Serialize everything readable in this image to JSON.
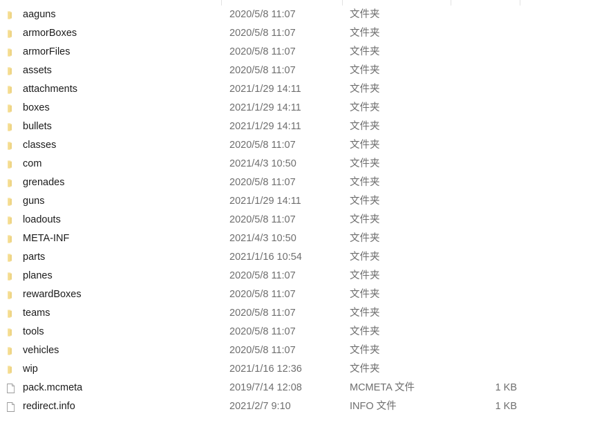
{
  "window": {
    "view": "details-list",
    "colors": {
      "folder_icon": "#f5dc8f",
      "folder_icon_dark": "#e7c765",
      "file_icon_fill": "#ffffff",
      "file_icon_border": "#9a9a9a",
      "name_text": "#1b1b1b",
      "meta_text": "#6e6e6e",
      "column_tick": "#e2e2e2",
      "background": "#ffffff"
    }
  },
  "columns": {
    "dividers_x": [
      320,
      495,
      652,
      752
    ],
    "keys": [
      "name",
      "date",
      "type",
      "size"
    ]
  },
  "items": [
    {
      "name": "aaguns",
      "date": "2020/5/8 11:07",
      "type": "文件夹",
      "size": "",
      "icon": "folder-icon"
    },
    {
      "name": "armorBoxes",
      "date": "2020/5/8 11:07",
      "type": "文件夹",
      "size": "",
      "icon": "folder-icon"
    },
    {
      "name": "armorFiles",
      "date": "2020/5/8 11:07",
      "type": "文件夹",
      "size": "",
      "icon": "folder-icon"
    },
    {
      "name": "assets",
      "date": "2020/5/8 11:07",
      "type": "文件夹",
      "size": "",
      "icon": "folder-icon"
    },
    {
      "name": "attachments",
      "date": "2021/1/29 14:11",
      "type": "文件夹",
      "size": "",
      "icon": "folder-icon"
    },
    {
      "name": "boxes",
      "date": "2021/1/29 14:11",
      "type": "文件夹",
      "size": "",
      "icon": "folder-icon"
    },
    {
      "name": "bullets",
      "date": "2021/1/29 14:11",
      "type": "文件夹",
      "size": "",
      "icon": "folder-icon"
    },
    {
      "name": "classes",
      "date": "2020/5/8 11:07",
      "type": "文件夹",
      "size": "",
      "icon": "folder-icon"
    },
    {
      "name": "com",
      "date": "2021/4/3 10:50",
      "type": "文件夹",
      "size": "",
      "icon": "folder-icon"
    },
    {
      "name": "grenades",
      "date": "2020/5/8 11:07",
      "type": "文件夹",
      "size": "",
      "icon": "folder-icon"
    },
    {
      "name": "guns",
      "date": "2021/1/29 14:11",
      "type": "文件夹",
      "size": "",
      "icon": "folder-icon"
    },
    {
      "name": "loadouts",
      "date": "2020/5/8 11:07",
      "type": "文件夹",
      "size": "",
      "icon": "folder-icon"
    },
    {
      "name": "META-INF",
      "date": "2021/4/3 10:50",
      "type": "文件夹",
      "size": "",
      "icon": "folder-icon"
    },
    {
      "name": "parts",
      "date": "2021/1/16 10:54",
      "type": "文件夹",
      "size": "",
      "icon": "folder-icon"
    },
    {
      "name": "planes",
      "date": "2020/5/8 11:07",
      "type": "文件夹",
      "size": "",
      "icon": "folder-icon"
    },
    {
      "name": "rewardBoxes",
      "date": "2020/5/8 11:07",
      "type": "文件夹",
      "size": "",
      "icon": "folder-icon"
    },
    {
      "name": "teams",
      "date": "2020/5/8 11:07",
      "type": "文件夹",
      "size": "",
      "icon": "folder-icon"
    },
    {
      "name": "tools",
      "date": "2020/5/8 11:07",
      "type": "文件夹",
      "size": "",
      "icon": "folder-icon"
    },
    {
      "name": "vehicles",
      "date": "2020/5/8 11:07",
      "type": "文件夹",
      "size": "",
      "icon": "folder-icon"
    },
    {
      "name": "wip",
      "date": "2021/1/16 12:36",
      "type": "文件夹",
      "size": "",
      "icon": "folder-icon"
    },
    {
      "name": "pack.mcmeta",
      "date": "2019/7/14 12:08",
      "type": "MCMETA 文件",
      "size": "1 KB",
      "icon": "file-icon"
    },
    {
      "name": "redirect.info",
      "date": "2021/2/7 9:10",
      "type": "INFO 文件",
      "size": "1 KB",
      "icon": "file-icon"
    }
  ]
}
